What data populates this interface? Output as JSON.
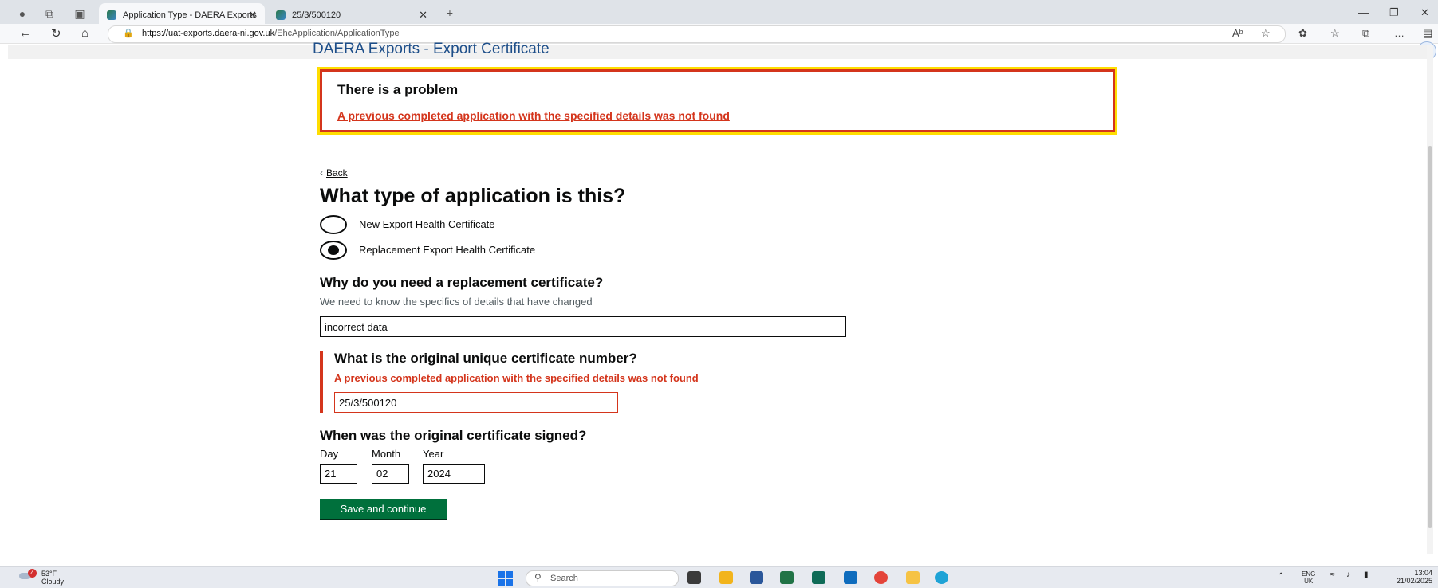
{
  "browser": {
    "tabs": [
      {
        "label": "Application Type - DAERA Exports",
        "active": true
      },
      {
        "label": "25/3/500120",
        "active": false
      }
    ],
    "url_host": "https://uat-exports.daera-ni.gov.uk",
    "url_path": "/EhcApplication/ApplicationType"
  },
  "header": {
    "title": "DAERA Exports - Export Certificate"
  },
  "error_summary": {
    "title": "There is a problem",
    "link": "A previous completed application with the specified details was not found"
  },
  "back_link": "Back",
  "question": {
    "title": "What type of application is this?",
    "options": [
      {
        "label": "New Export Health Certificate",
        "selected": false
      },
      {
        "label": "Replacement Export Health Certificate",
        "selected": true
      }
    ]
  },
  "reason": {
    "label": "Why do you need a replacement certificate?",
    "hint": "We need to know the specifics of details that have changed",
    "value": "incorrect data"
  },
  "original_number": {
    "label": "What is the original unique certificate number?",
    "error": "A previous completed application with the specified details was not found",
    "value": "25/3/500120"
  },
  "signed_date": {
    "label": "When was the original certificate signed?",
    "day_label": "Day",
    "month_label": "Month",
    "year_label": "Year",
    "day": "21",
    "month": "02",
    "year": "2024"
  },
  "submit": {
    "label": "Save and continue"
  },
  "colors": {
    "error": "#d4351c",
    "focus": "#ffdd00",
    "button": "#00703c",
    "header_text": "#1d4e89"
  },
  "taskbar": {
    "weather": {
      "temp": "53°F",
      "condition": "Cloudy",
      "badge": "4"
    },
    "search_placeholder": "Search",
    "lang": "ENG",
    "region": "UK",
    "time": "13:04",
    "date": "21/02/2025"
  }
}
